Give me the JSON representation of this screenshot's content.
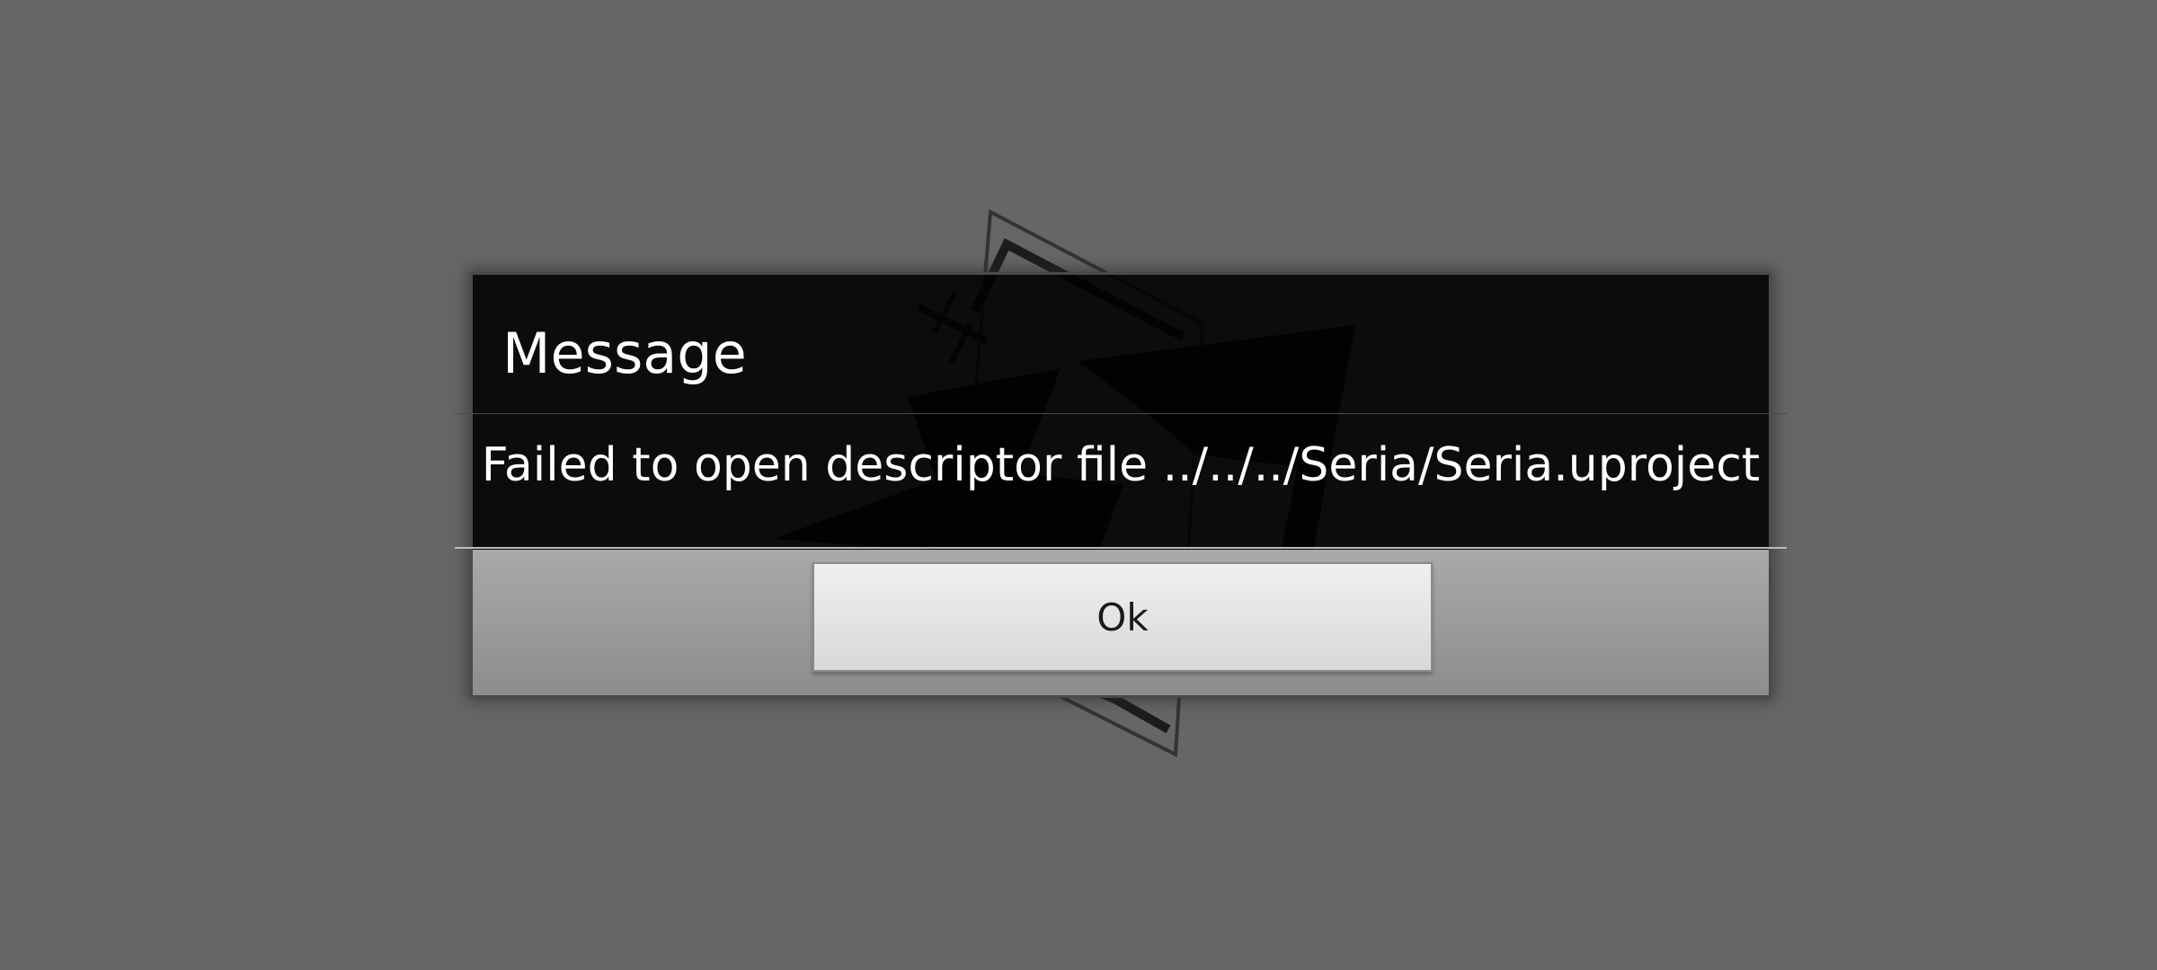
{
  "dialog": {
    "title": "Message",
    "message": "Failed to open descriptor file ../../../Seria/Seria.uproject",
    "ok_label": "Ok"
  },
  "colors": {
    "background": "#666666",
    "dialog_body": "#0b0b0b",
    "footer": "#9a9a9a",
    "button": "#e4e4e4"
  },
  "icons": {
    "splash_logo": "game-logo-icon"
  }
}
